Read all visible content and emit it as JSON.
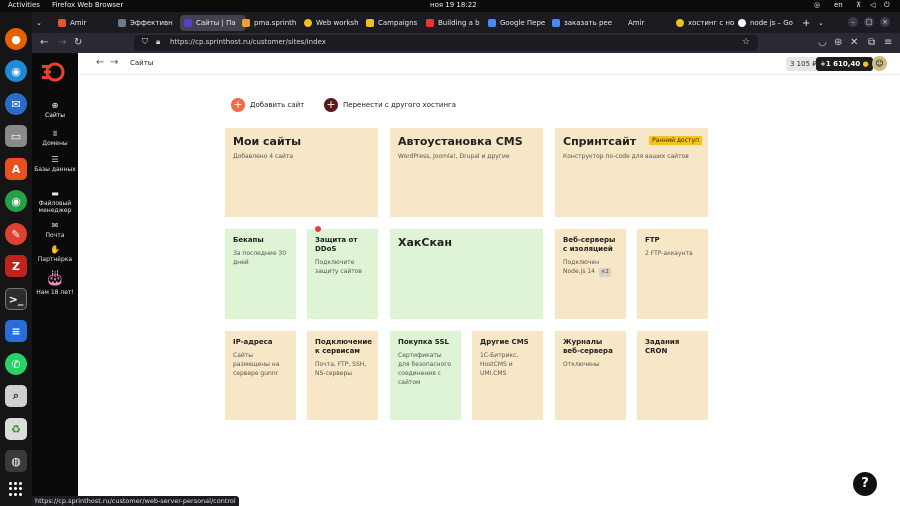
{
  "system": {
    "activities": "Activities",
    "app_name": "Firefox Web Browser",
    "clock": "ноя 19  18:22",
    "language": "en"
  },
  "browser": {
    "tabs": [
      {
        "label": "Amir",
        "color": "#e8542e"
      },
      {
        "label": "Эффективн",
        "color": "#6e7a8a"
      },
      {
        "label": "Сайты | Па",
        "color": "#5a3dc8",
        "active": true
      },
      {
        "label": "pma.sprinth",
        "color": "#f0a030"
      },
      {
        "label": "Web worksh",
        "color": "#f0c020"
      },
      {
        "label": "Campaigns",
        "color": "#f0c020"
      },
      {
        "label": "Building a b",
        "color": "#e33"
      },
      {
        "label": "Google Пере",
        "color": "#4a8af0"
      },
      {
        "label": "заказать рее",
        "color": "#4a8af0"
      },
      {
        "label": "Amir",
        "color": "#1c1b22"
      },
      {
        "label": "хостинг с но",
        "color": "#f0c020"
      },
      {
        "label": "node js – Go",
        "color": "#ffffff"
      }
    ],
    "url": "https://cp.sprinthost.ru/customer/sites/index",
    "status_url": "https://cp.sprinthost.ru/customer/web-server-personal/control"
  },
  "sidebar": {
    "items": [
      {
        "label": "Сайты",
        "icon": "globe-icon"
      },
      {
        "label": "Домены",
        "icon": "www-icon"
      },
      {
        "label": "Базы данных",
        "icon": "database-icon"
      },
      {
        "label": "Файловый менеджер",
        "icon": "folder-icon"
      },
      {
        "label": "Почта",
        "icon": "mail-icon"
      },
      {
        "label": "Партнёрка",
        "icon": "partner-icon"
      },
      {
        "label": "Нам 18 лет!",
        "icon": "cake-icon"
      }
    ]
  },
  "header": {
    "breadcrumb": "Сайты",
    "balance": "3 105 ₽",
    "bonus": "+1 610,40"
  },
  "actions": {
    "add_site": "Добавить сайт",
    "transfer": "Перенести с другого хостинга"
  },
  "cards": {
    "my_sites": {
      "title": "Мои сайты",
      "desc": "Добавлено 4 сайта"
    },
    "autoinstall": {
      "title": "Автоустановка CMS",
      "desc": "WordPress, Joomla!, Drupal и другие"
    },
    "sprintsite": {
      "title": "Спринтсайт",
      "desc": "Конструктор по-code для ваших сайтов",
      "badge": "Ранний доступ"
    },
    "backups": {
      "title": "Бекапы",
      "desc": "За последние 30 дней"
    },
    "ddos": {
      "title": "Защита от DDoS",
      "desc": "Подключите защиту сайтов"
    },
    "haxscan": {
      "title": "ХакСкан"
    },
    "webservers": {
      "title": "Веб-серверы с изоляцией",
      "desc": "Подключен Node.js 14",
      "chip": "×2"
    },
    "ftp": {
      "title": "FTP",
      "desc": "2 FTP-аккаунта"
    },
    "ip": {
      "title": "IP-адреса",
      "desc": "Сайты размещены на сервере gunnr"
    },
    "services": {
      "title": "Подключение к сервисам",
      "desc": "Почта, FTP, SSH, NS-серверы"
    },
    "ssl": {
      "title": "Покупка SSL",
      "desc": "Сертификаты для безопасного соединения с сайтом"
    },
    "other_cms": {
      "title": "Другие CMS",
      "desc": "1С-Битрикс, HostCMS и UMI.CMS"
    },
    "logs": {
      "title": "Журналы веб-сервера",
      "desc": "Отключены"
    },
    "cron": {
      "title": "Задания CRON"
    }
  },
  "help": "?"
}
